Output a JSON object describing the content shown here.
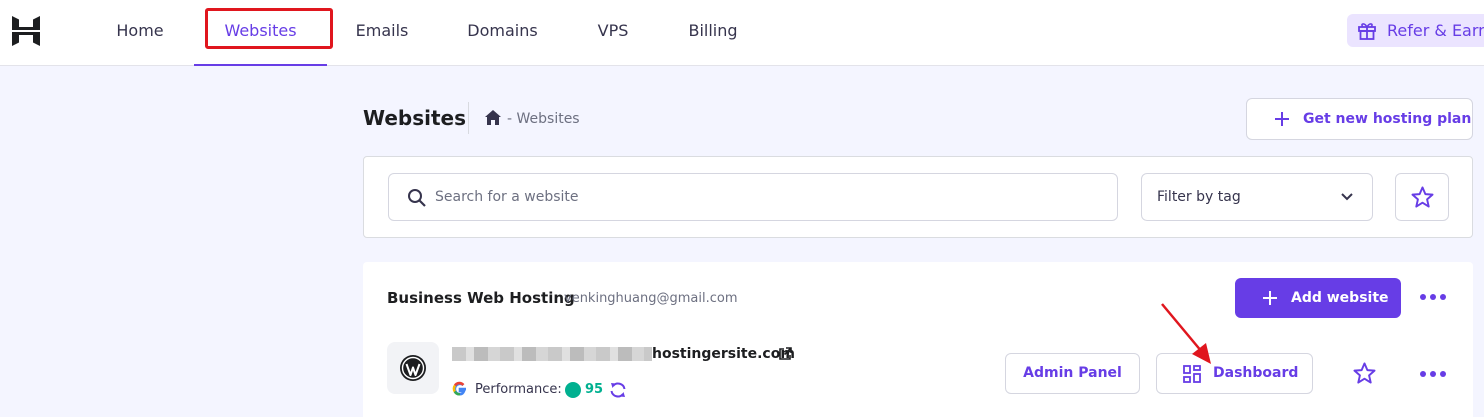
{
  "nav": {
    "items": [
      {
        "label": "Home"
      },
      {
        "label": "Websites"
      },
      {
        "label": "Emails"
      },
      {
        "label": "Domains"
      },
      {
        "label": "VPS"
      },
      {
        "label": "Billing"
      }
    ],
    "active": "Websites",
    "refer_label": "Refer & Earn"
  },
  "header": {
    "title": "Websites",
    "breadcrumb": "- Websites",
    "get_plan_label": "Get new hosting plan"
  },
  "search": {
    "placeholder": "Search for a website",
    "filter_label": "Filter by tag"
  },
  "plan": {
    "name": "Business Web Hosting",
    "email": "venkinghuang@gmail.com",
    "add_website_label": "Add website"
  },
  "site": {
    "domain_suffix": "hostingersite.com",
    "performance_label": "Performance:",
    "performance_score": "95",
    "admin_panel_label": "Admin Panel",
    "dashboard_label": "Dashboard"
  },
  "colors": {
    "accent": "#673de6",
    "good": "#00b090",
    "annotation": "#e0161e"
  },
  "icons": [
    "hostinger-logo",
    "gift-icon",
    "home-icon",
    "plus-icon",
    "search-icon",
    "chevron-down-icon",
    "star-icon",
    "more-icon",
    "wordpress-icon",
    "external-link-icon",
    "google-icon",
    "refresh-icon",
    "dashboard-grid-icon"
  ]
}
